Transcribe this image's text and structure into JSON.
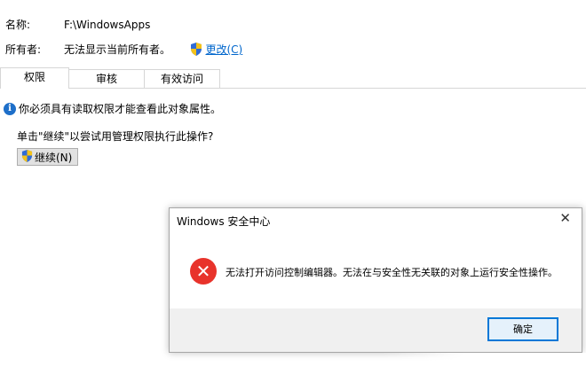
{
  "header": {
    "name_label": "名称:",
    "name_value": "F:\\WindowsApps",
    "owner_label": "所有者:",
    "owner_value": "无法显示当前所有者。",
    "change_link": "更改(C)"
  },
  "tabs": [
    {
      "label": "权限",
      "active": true
    },
    {
      "label": "审核",
      "active": false
    },
    {
      "label": "有效访问",
      "active": false
    }
  ],
  "main": {
    "info_text": "你必须具有读取权限才能查看此对象属性。",
    "prompt_text": "单击\"继续\"以尝试用管理权限执行此操作?",
    "continue_label": "继续(N)"
  },
  "dialog": {
    "title": "Windows 安全中心",
    "close_glyph": "✕",
    "message": "无法打开访问控制编辑器。无法在与安全性无关联的对象上运行安全性操作。",
    "ok_label": "确定"
  },
  "colors": {
    "accent": "#0078d7",
    "link": "#0066cc",
    "error": "#e8332b",
    "info": "#1e6fc9"
  },
  "icons": [
    "uac-shield-icon",
    "info-icon",
    "error-icon",
    "close-icon"
  ]
}
